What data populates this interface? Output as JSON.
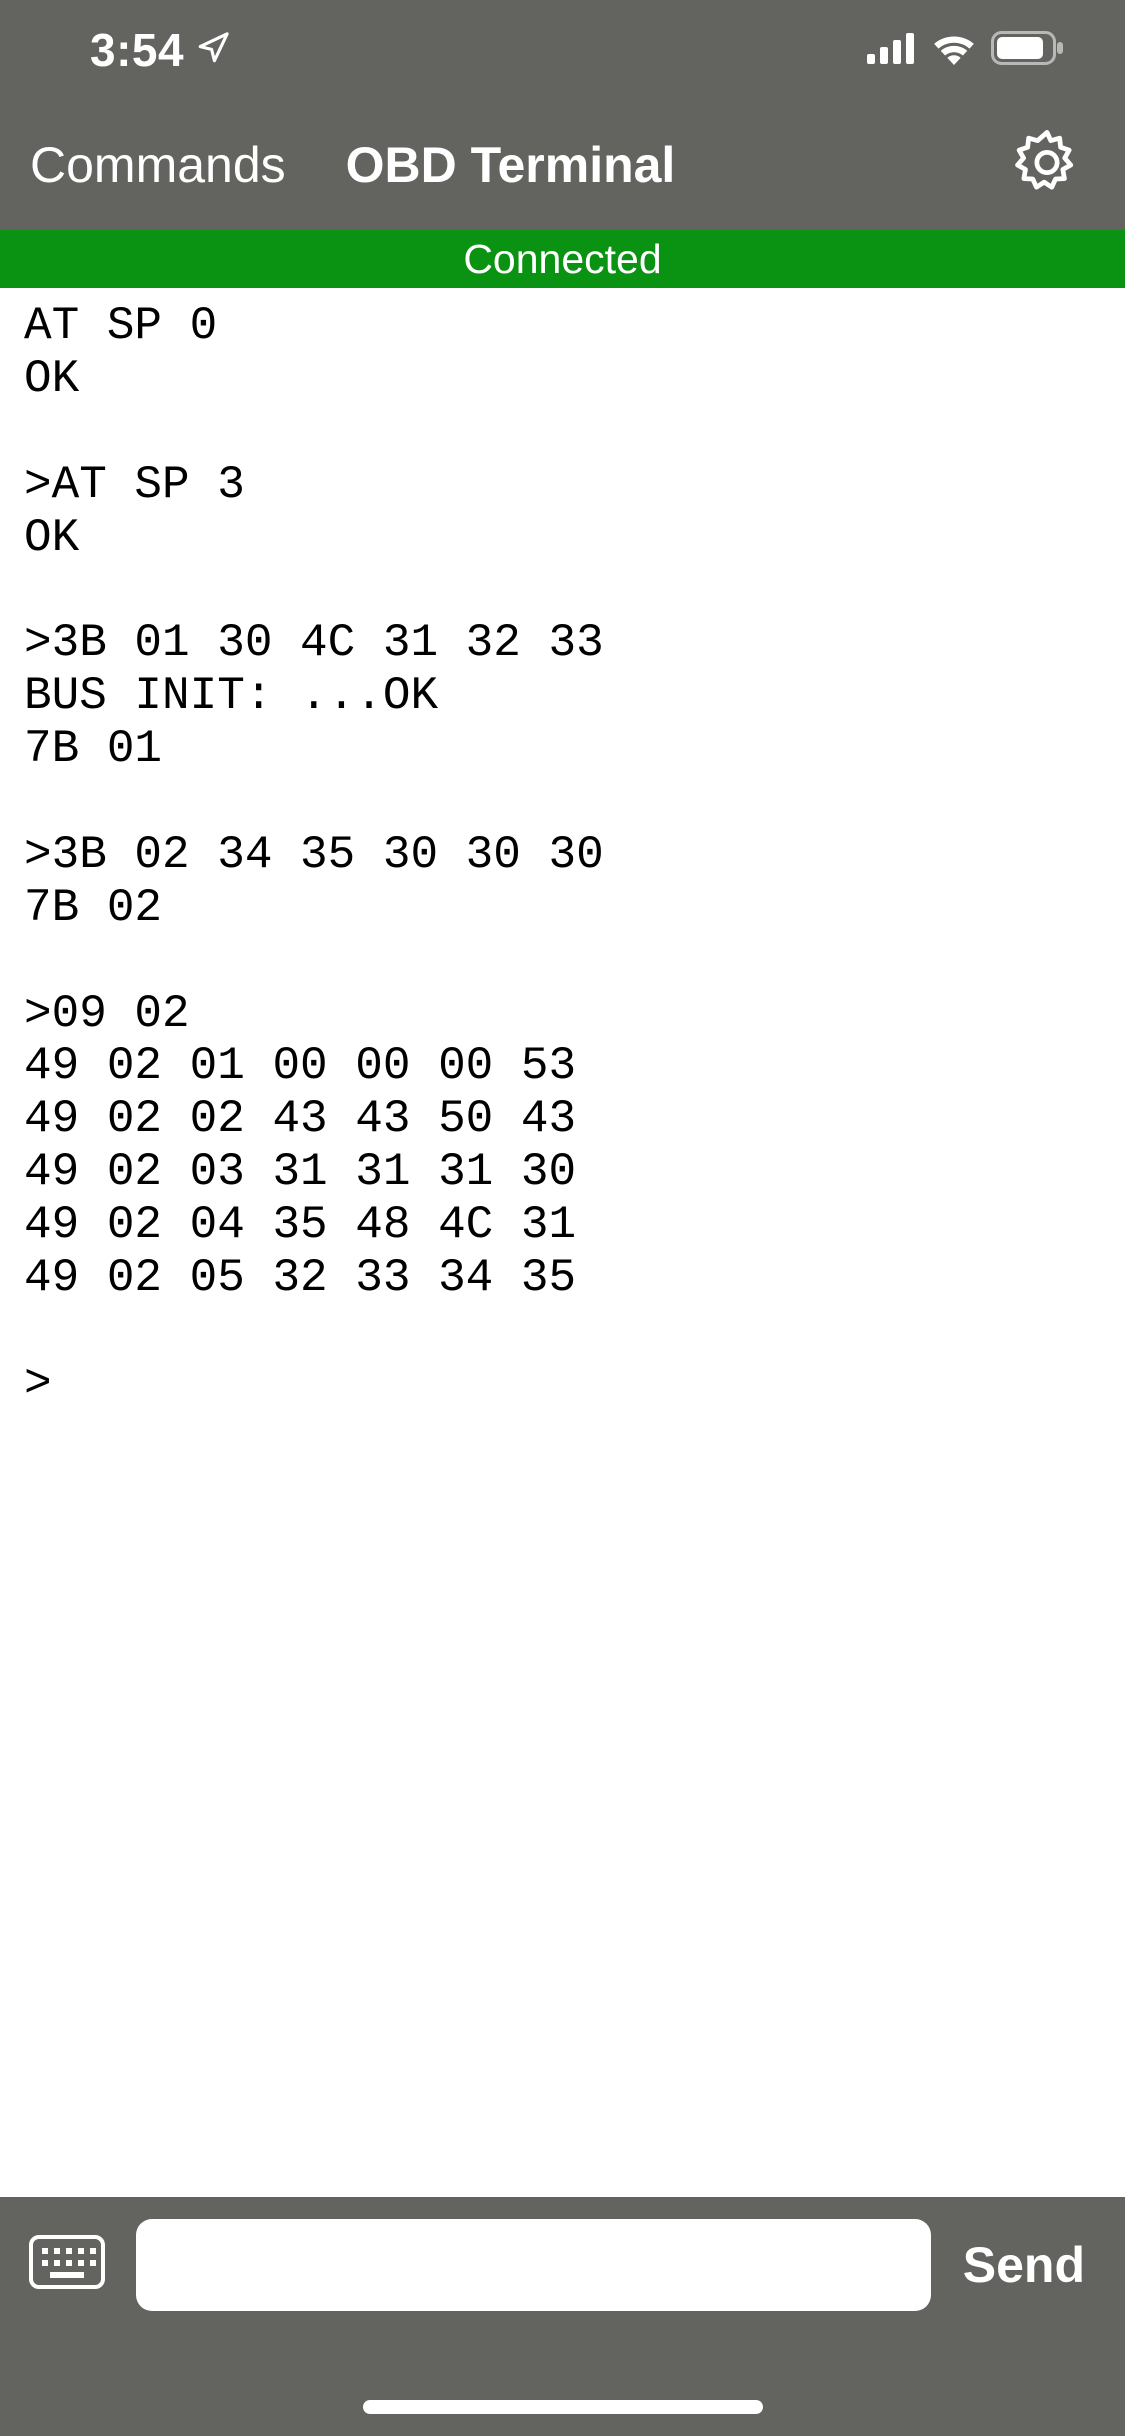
{
  "status_bar": {
    "time": "3:54"
  },
  "nav": {
    "back_label": "Commands",
    "title": "OBD Terminal"
  },
  "banner": {
    "text": "Connected"
  },
  "terminal_output": "AT SP 0\nOK\n\n>AT SP 3\nOK\n\n>3B 01 30 4C 31 32 33\nBUS INIT: ...OK\n7B 01 \n\n>3B 02 34 35 30 30 30\n7B 02 \n\n>09 02\n49 02 01 00 00 00 53 \n49 02 02 43 43 50 43 \n49 02 03 31 31 31 30 \n49 02 04 35 48 4C 31 \n49 02 05 32 33 34 35 \n\n>",
  "input": {
    "value": "",
    "placeholder": ""
  },
  "send_label": "Send"
}
